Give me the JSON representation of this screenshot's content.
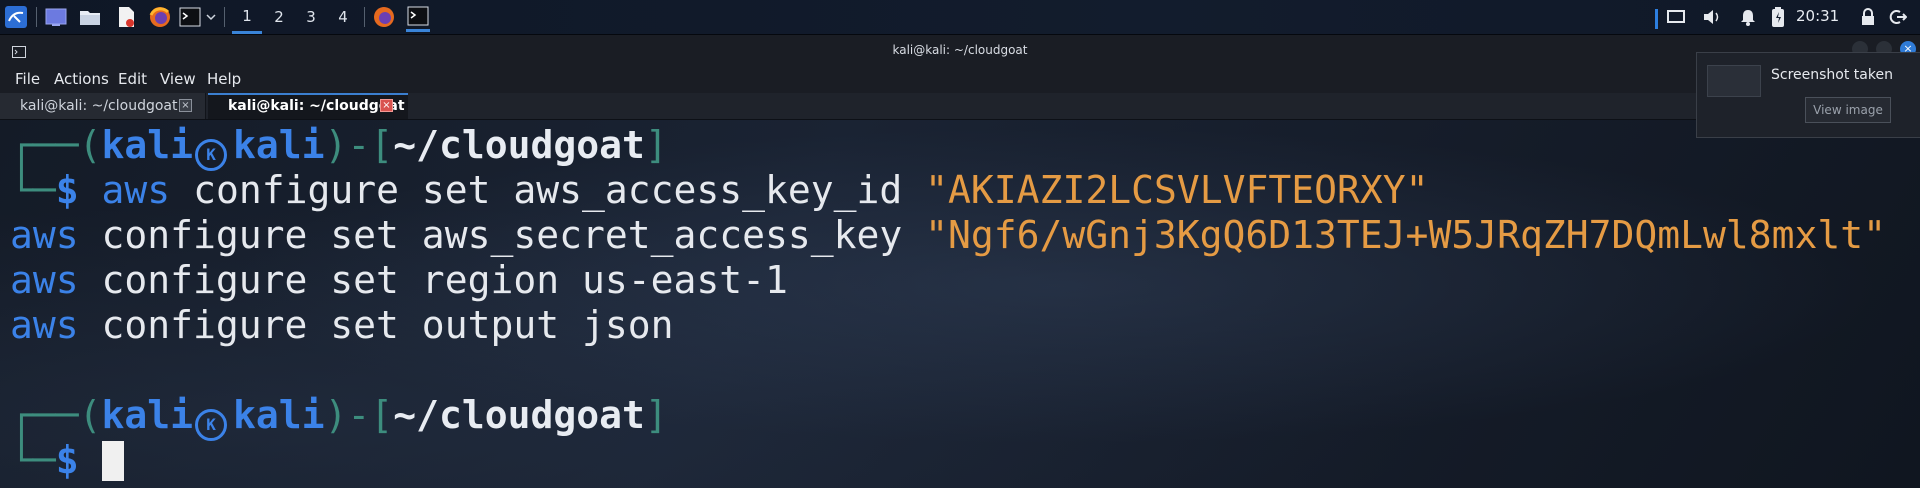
{
  "panel": {
    "workspaces": [
      "1",
      "2",
      "3",
      "4"
    ],
    "active_workspace": "1",
    "clock": "20:31",
    "icons": [
      "kali-menu-icon",
      "desktop-icon",
      "file-manager-icon",
      "text-editor-icon",
      "firefox-icon",
      "terminal-icon",
      "chevron-down-icon",
      "firefox-task-icon",
      "terminal-task-icon",
      "cpu-graph-icon",
      "display-icon",
      "volume-icon",
      "notifications-icon",
      "battery-icon",
      "lock-icon",
      "logout-icon"
    ]
  },
  "window": {
    "title": "kali@kali: ~/cloudgoat",
    "menu": [
      "File",
      "Actions",
      "Edit",
      "View",
      "Help"
    ],
    "tabs": [
      {
        "label": "kali@kali: ~/cloudgoat",
        "active": false
      },
      {
        "label": "kali@kali: ~/cloudgoat",
        "active": true
      }
    ]
  },
  "terminal": {
    "prompt1": {
      "user": "kali",
      "host": "kali",
      "path": "~/cloudgoat",
      "symbol": "$"
    },
    "commands": [
      {
        "cmd": "aws",
        "args": " configure set aws_access_key_id ",
        "value": "\"AKIAZI2LCSVLVFTEORXY\""
      },
      {
        "cmd": "aws",
        "args": " configure set aws_secret_access_key ",
        "value": "\"Ngf6/wGnj3KgQ6D13TEJ+W5JRqZH7DQmLwl8mxlt\""
      },
      {
        "cmd": "aws",
        "args": " configure set region us-east-1",
        "value": ""
      },
      {
        "cmd": "aws",
        "args": " configure set output json",
        "value": ""
      }
    ],
    "prompt2": {
      "user": "kali",
      "host": "kali",
      "path": "~/cloudgoat",
      "symbol": "$"
    }
  },
  "notification": {
    "title": "Screenshot taken",
    "button": "View image"
  },
  "colors": {
    "accent": "#3b82e8",
    "string": "#e59b44",
    "frame": "#3d8d7e",
    "background": "#141b27"
  }
}
